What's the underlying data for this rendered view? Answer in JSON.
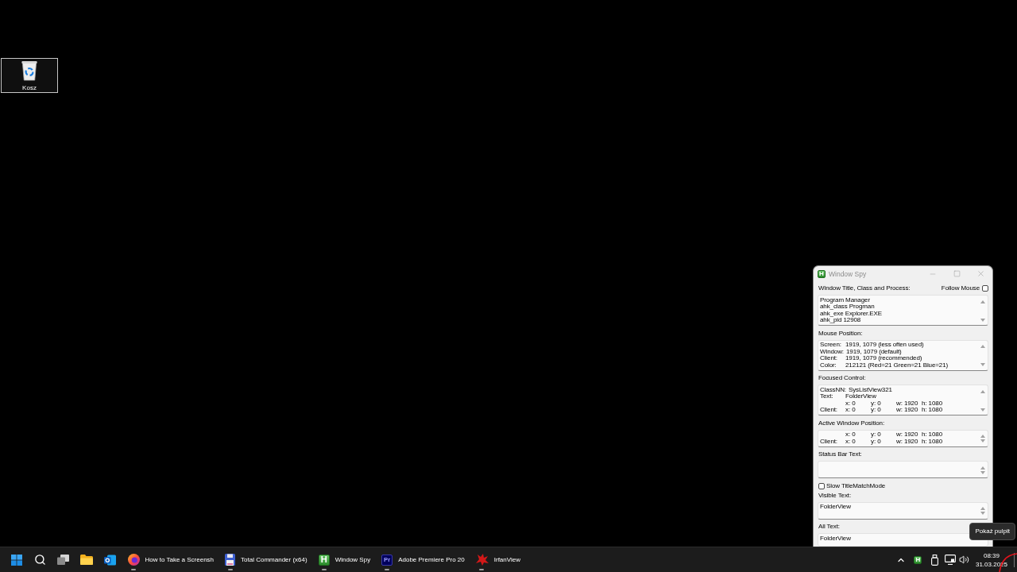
{
  "desktop": {
    "icons": [
      {
        "label": "Kosz",
        "selected": true
      }
    ]
  },
  "window": {
    "icon_glyph": "H",
    "title": "Window Spy",
    "sections": [
      {
        "kind": "field",
        "label": "Window Title, Class and Process:",
        "option": {
          "label": "Follow Mouse",
          "checked": false
        },
        "lines": [
          "Program Manager",
          "ahk_class Progman",
          "ahk_exe Explorer.EXE",
          "ahk_pid 12908"
        ]
      },
      {
        "kind": "field",
        "label": "Mouse Position:",
        "rows": [
          {
            "label": "Screen:",
            "values": [
              "1919, 1079 (less often used)"
            ]
          },
          {
            "label": "Window:",
            "values": [
              "1919, 1079 (default)"
            ]
          },
          {
            "label": "Client:",
            "values": [
              "1919, 1079 (recommended)"
            ]
          },
          {
            "label": "Color:",
            "values": [
              "212121 (Red=21 Green=21 Blue=21)"
            ]
          }
        ]
      },
      {
        "kind": "field",
        "label": "Focused Control:",
        "rows": [
          {
            "label": "ClassNN:",
            "values": [
              "SysListView321"
            ]
          },
          {
            "label": "Text:",
            "values": [
              "FolderView"
            ]
          },
          {
            "values": [
              "x: 0",
              "y: 0",
              "w: 1920",
              "h: 1080"
            ]
          },
          {
            "label": "Client:",
            "values": [
              "x: 0",
              "y: 0",
              "w: 1920",
              "h: 1080"
            ]
          }
        ]
      },
      {
        "kind": "field",
        "label": "Active Window Position:",
        "rows": [
          {
            "values": [
              "x: 0",
              "y: 0",
              "w: 1920",
              "h: 1080"
            ]
          },
          {
            "label": "Client:",
            "values": [
              "x: 0",
              "y: 0",
              "w: 1920",
              "h: 1080"
            ]
          }
        ]
      },
      {
        "kind": "field",
        "label": "Status Bar Text:"
      },
      {
        "kind": "checkbox",
        "label": "Slow TitleMatchMode",
        "checked": false
      },
      {
        "kind": "field",
        "label": "Visible Text:",
        "lines": [
          "FolderView"
        ]
      },
      {
        "kind": "field",
        "label": "All Text:",
        "lines": [
          "FolderView"
        ]
      }
    ]
  },
  "taskbar": {
    "apps": [
      {
        "kind": "browser",
        "label": "How to Take a Screensh",
        "running": true
      },
      {
        "kind": "files",
        "label": "Total Commander (x64)",
        "running": true
      },
      {
        "kind": "script",
        "glyph": "H",
        "label": "Window Spy",
        "running": true
      },
      {
        "kind": "video",
        "glyph": "Pr",
        "label": "Adobe Premiere Pro 20",
        "running": true
      },
      {
        "kind": "photo",
        "label": "IrfanView",
        "running": true
      }
    ],
    "tray": [
      {
        "kind": "chevron"
      },
      {
        "kind": "script",
        "glyph": "H"
      },
      {
        "kind": "drive"
      },
      {
        "kind": "network"
      },
      {
        "kind": "volume"
      }
    ],
    "clock": {
      "time": "08:39",
      "date": "31.03.2025"
    }
  },
  "tooltip": {
    "text": "Pokaż pulpit"
  }
}
